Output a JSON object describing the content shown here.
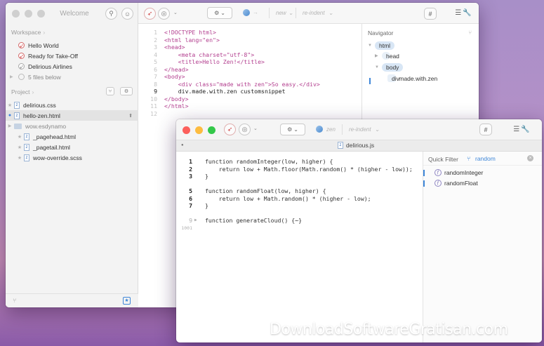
{
  "window1": {
    "title": "Welcome",
    "toolbar": {
      "new_label": "new",
      "reindent_label": "re-indent",
      "hash_label": "#"
    },
    "workspace": {
      "header": "Workspace",
      "items": [
        {
          "label": "Hello World",
          "icon": "compass-icon"
        },
        {
          "label": "Ready for Take-Off",
          "icon": "compass-icon"
        },
        {
          "label": "Delirious Airlines",
          "icon": "compass-icon"
        }
      ],
      "more_label": "5 files below"
    },
    "project": {
      "header": "Project",
      "files": [
        {
          "label": "delirious.css",
          "selected": false
        },
        {
          "label": "hello-zen.html",
          "selected": true
        },
        {
          "label": "wow.esdynamo",
          "folder": true
        },
        {
          "label": "_pagehead.html",
          "selected": false
        },
        {
          "label": "_pagetail.html",
          "selected": false
        },
        {
          "label": "wow-override.scss",
          "selected": false
        }
      ]
    },
    "editor": {
      "line_numbers": [
        "1",
        "2",
        "3",
        "4",
        "5",
        "6",
        "7",
        "8",
        "9",
        "10",
        "11",
        "12"
      ],
      "lines": [
        "<!DOCTYPE html>",
        "<html lang=\"en\">",
        "<head>",
        "    <meta charset=\"utf-8\">",
        "    <title>Hello Zen!</title>",
        "</head>",
        "<body>",
        "    <div class=\"made with zen\">So easy.</div>",
        "    div.made.with.zen customsnippet",
        "</body>",
        "</html>",
        ""
      ]
    },
    "navigator": {
      "title": "Navigator",
      "nodes": [
        {
          "label": "html"
        },
        {
          "label": "head"
        },
        {
          "label": "body"
        },
        {
          "label": "div",
          "suffix": ".made.with.zen"
        }
      ]
    }
  },
  "window2": {
    "toolbar": {
      "zen_label": "zen",
      "reindent_label": "re-indent",
      "hash_label": "#"
    },
    "tab_title": "delirious.js",
    "editor": {
      "line_numbers": [
        "1",
        "2",
        "3",
        "",
        "5",
        "6",
        "7",
        "",
        "9",
        "1001"
      ],
      "lines": [
        "function randomInteger(low, higher) {",
        "    return low + Math.floor(Math.random() * (higher - low));",
        "}",
        "",
        "function randomFloat(low, higher) {",
        "    return low + Math.random() * (higher - low);",
        "}",
        "",
        "function generateCloud() {⋯}",
        ""
      ]
    },
    "quick_filter": {
      "label": "Quick Filter",
      "value": "random",
      "results": [
        "randomInteger",
        "randomFloat"
      ]
    }
  },
  "watermark": "DownloadSoftwareGratisan.com",
  "colors": {
    "close": "#fc605c",
    "minimize": "#fdbc40",
    "zoom": "#34c84a",
    "accent": "#3e86d8"
  }
}
